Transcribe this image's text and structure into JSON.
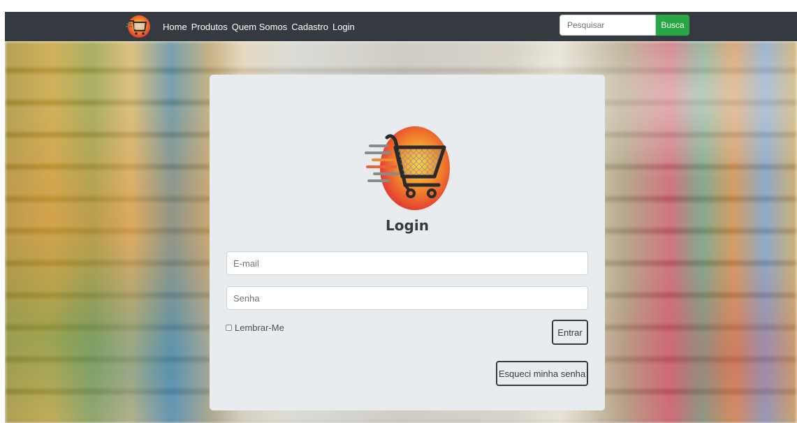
{
  "navbar": {
    "logo_icon": "shopping-cart-logo-icon",
    "links": [
      "Home",
      "Produtos",
      "Quem Somos",
      "Cadastro",
      "Login"
    ],
    "search": {
      "placeholder": "Pesquisar",
      "button_label": "Busca"
    }
  },
  "login_card": {
    "logo_icon": "shopping-cart-logo-icon",
    "title": "Login",
    "email_placeholder": "E-mail",
    "password_placeholder": "Senha",
    "remember_label": "Lembrar-Me",
    "remember_checked": false,
    "submit_label": "Entrar",
    "forgot_label": "Esqueci minha senha"
  },
  "colors": {
    "navbar_bg": "#343a40",
    "search_button": "#28a745",
    "card_bg": "#e9ecef",
    "logo_orange": "#f07d2b",
    "logo_red": "#e84a3a"
  }
}
